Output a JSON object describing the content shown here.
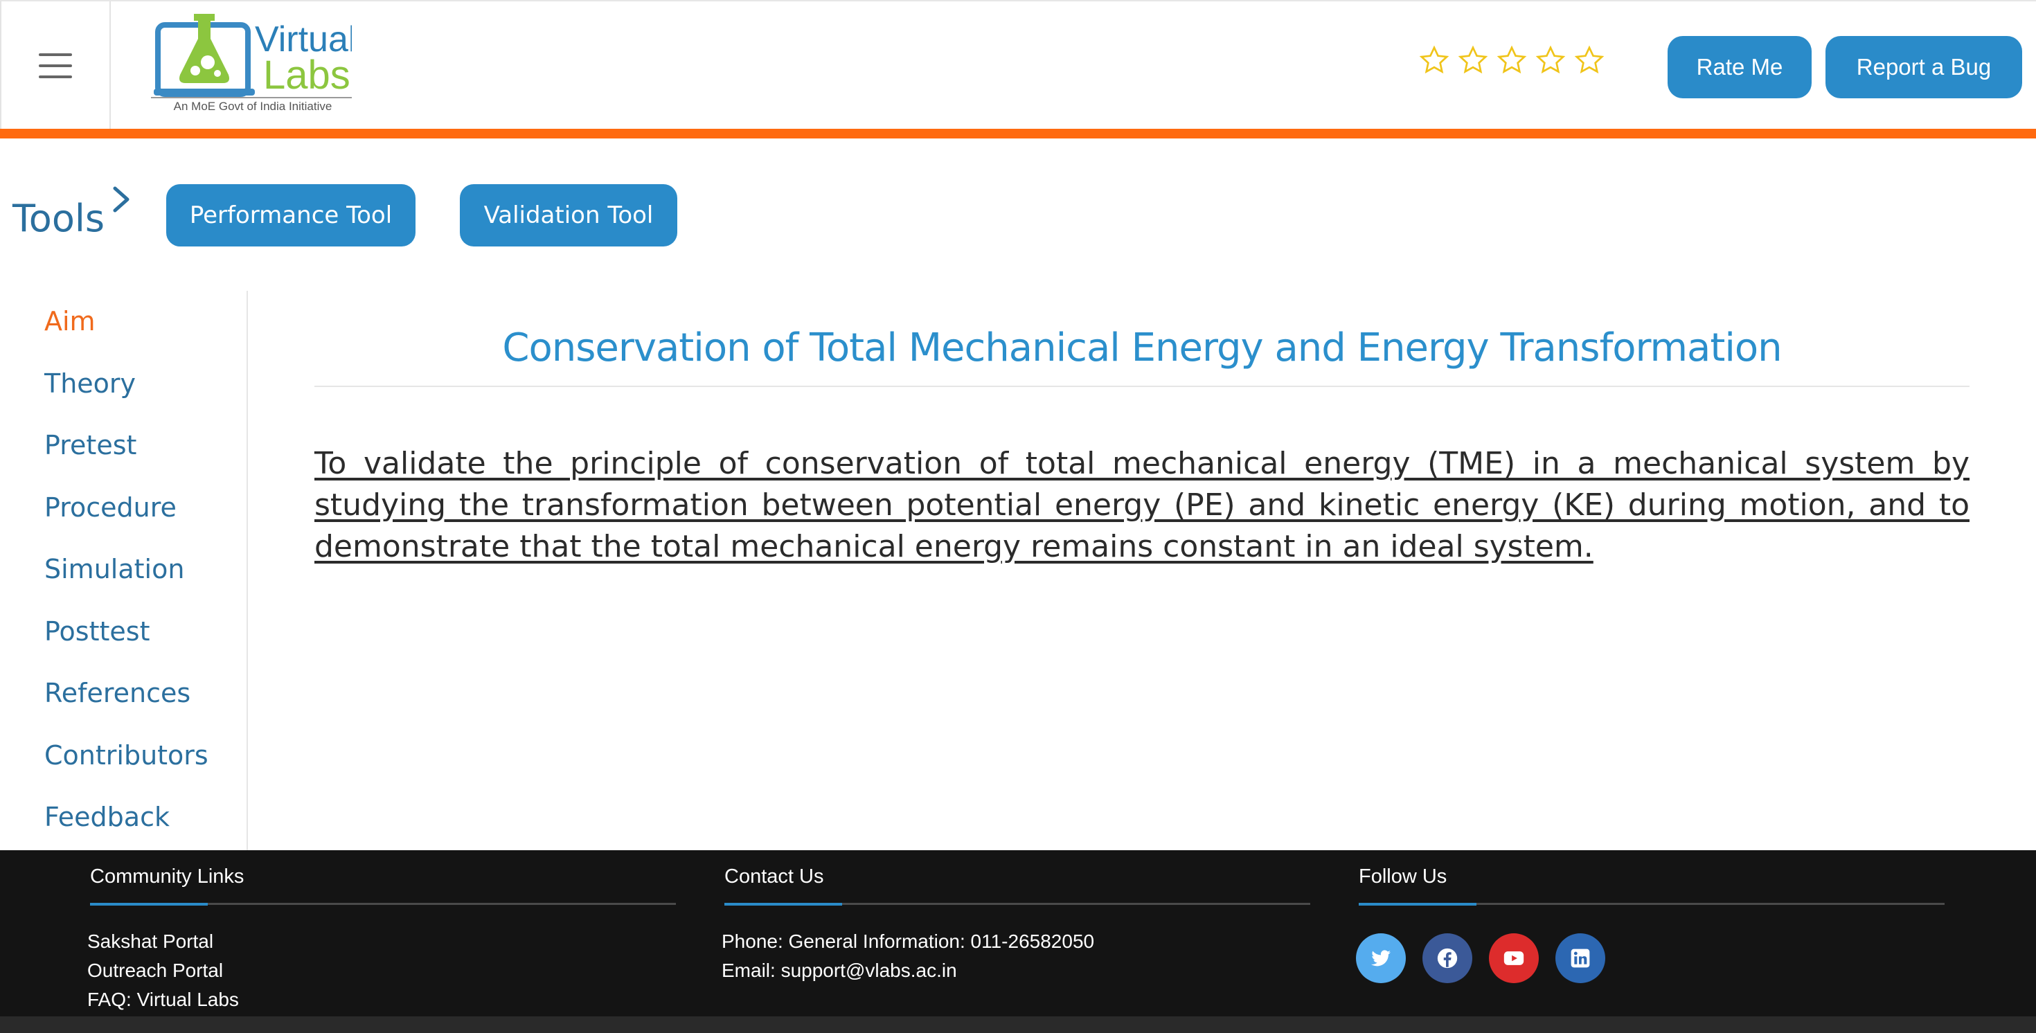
{
  "header": {
    "logo_text_top": "Virtual",
    "logo_text_bottom": "Labs",
    "logo_tagline": "An MoE Govt of India Initiative",
    "rating_stars": 0,
    "rating_max": 5,
    "rate_label": "Rate Me",
    "bug_label": "Report a Bug",
    "accent_color": "#ff6a10",
    "button_color": "#2a8bc9"
  },
  "tools": {
    "label": "Tools",
    "performance_label": "Performance Tool",
    "validation_label": "Validation Tool"
  },
  "sidebar": {
    "items": [
      {
        "label": "Aim",
        "active": true
      },
      {
        "label": "Theory"
      },
      {
        "label": "Pretest"
      },
      {
        "label": "Procedure"
      },
      {
        "label": "Simulation"
      },
      {
        "label": "Posttest"
      },
      {
        "label": "References"
      },
      {
        "label": "Contributors"
      },
      {
        "label": "Feedback"
      }
    ]
  },
  "main": {
    "title": "Conservation of Total Mechanical Energy and Energy Transformation",
    "aim": "To validate the principle of conservation of total mechanical energy (TME) in a mechanical system by studying the transformation between potential energy (PE) and kinetic energy (KE) during motion, and to demonstrate that the total mechanical energy remains constant in an ideal system."
  },
  "footer": {
    "community": {
      "heading": "Community Links",
      "links": [
        "Sakshat Portal",
        "Outreach Portal",
        "FAQ: Virtual Labs"
      ]
    },
    "contact": {
      "heading": "Contact Us",
      "phone": "Phone: General Information: 011-26582050",
      "email": "Email: support@vlabs.ac.in"
    },
    "follow": {
      "heading": "Follow Us",
      "icons": [
        {
          "name": "twitter-icon",
          "color": "#55acee"
        },
        {
          "name": "facebook-icon",
          "color": "#3b5998"
        },
        {
          "name": "youtube-icon",
          "color": "#dd2c2c"
        },
        {
          "name": "linkedin-icon",
          "color": "#2c67b2"
        }
      ]
    }
  }
}
